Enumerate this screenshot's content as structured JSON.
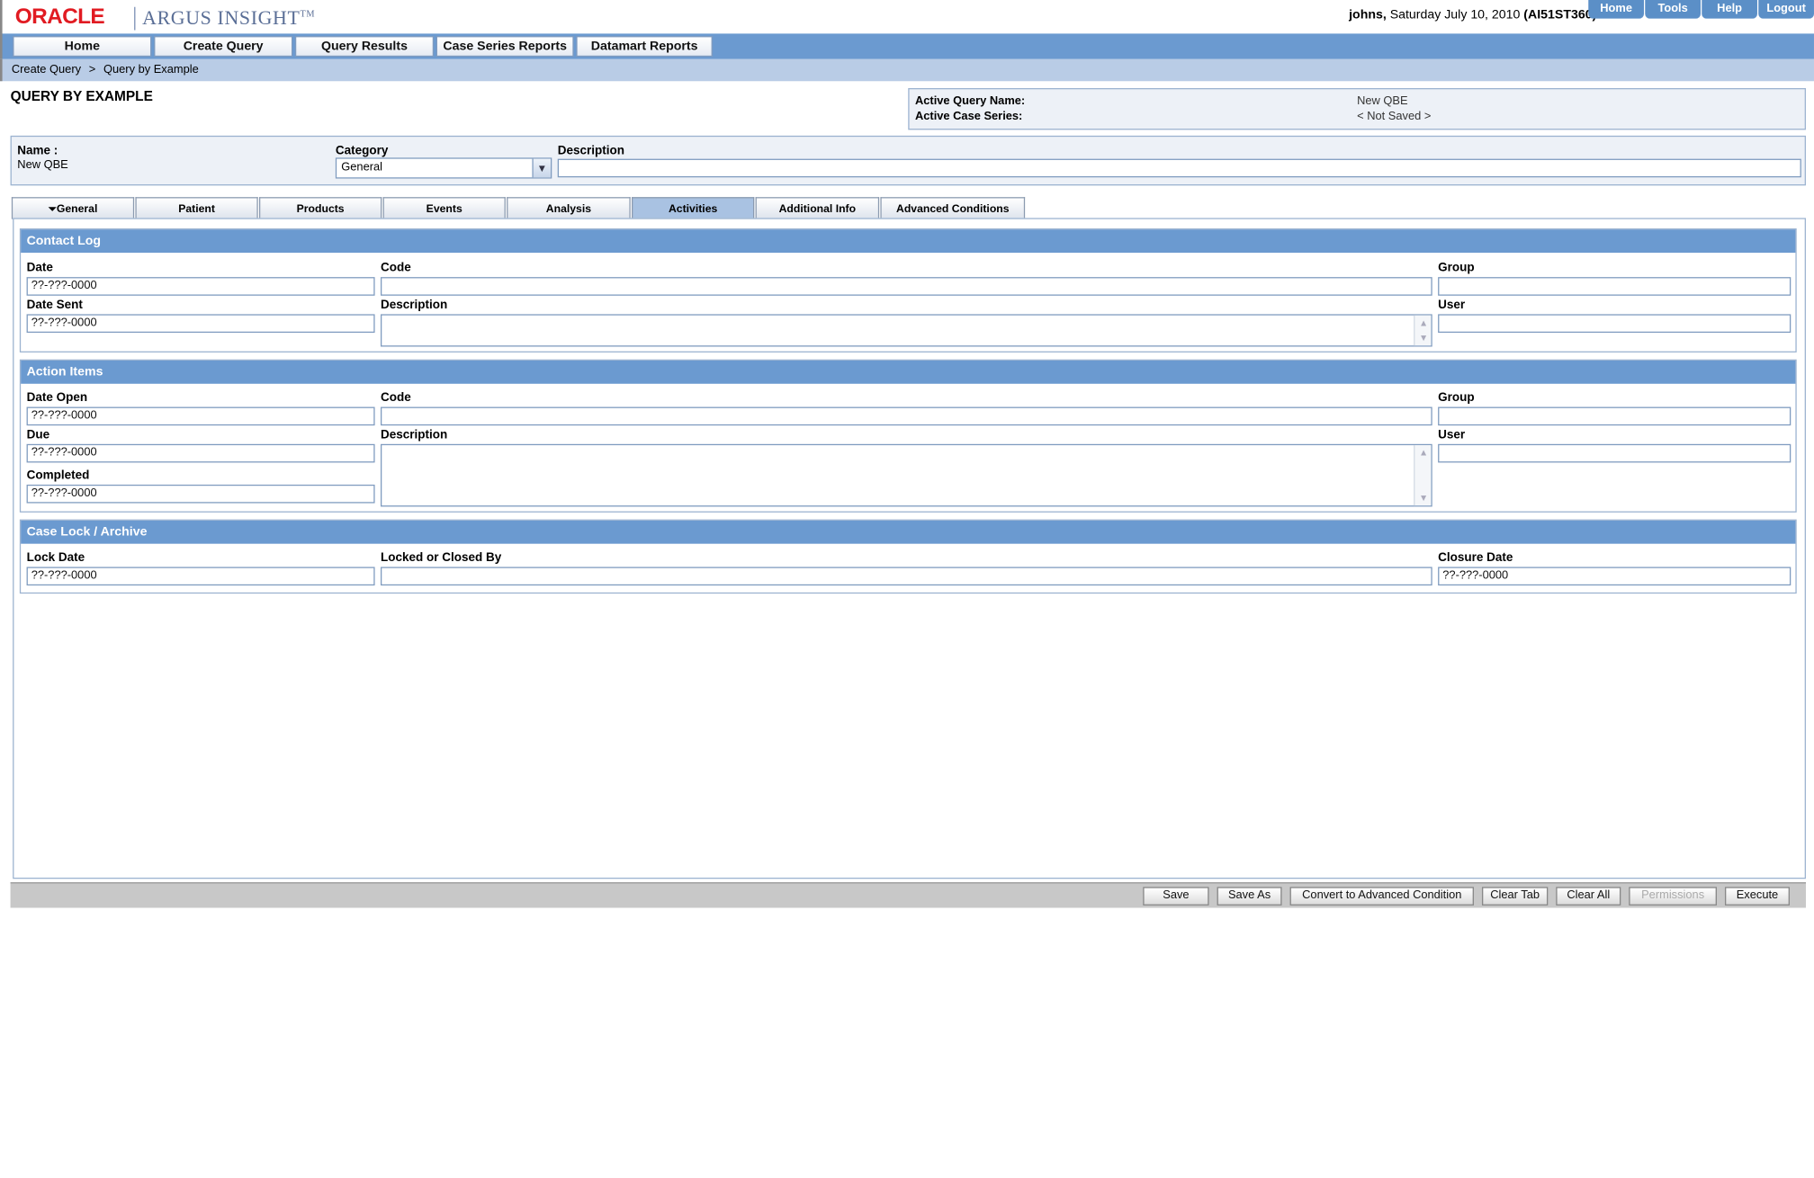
{
  "header": {
    "logo_oracle": "ORACLE",
    "logo_argus": "ARGUS INSIGHT",
    "logo_tm": "TM",
    "user": "johns,",
    "date": " Saturday July 10, 2010 ",
    "server": "(AI51ST360)",
    "top_links": [
      "Home",
      "Tools",
      "Help",
      "Logout"
    ]
  },
  "nav": {
    "items": [
      "Home",
      "Create Query",
      "Query Results",
      "Case Series Reports",
      "Datamart Reports"
    ]
  },
  "breadcrumb": {
    "parent": "Create Query",
    "separator": ">",
    "current": "Query by Example"
  },
  "page": {
    "title": "QUERY BY EXAMPLE"
  },
  "active": {
    "query_name_label": "Active Query Name:",
    "query_name_value": "New QBE",
    "case_series_label": "Active Case Series:",
    "case_series_value": "< Not Saved >"
  },
  "query_meta": {
    "name_label": "Name :",
    "name_value": "New QBE",
    "category_label": "Category",
    "category_value": "General",
    "description_label": "Description",
    "description_value": ""
  },
  "tabs": [
    {
      "label": "General",
      "icon": "filter-icon"
    },
    {
      "label": "Patient"
    },
    {
      "label": "Products"
    },
    {
      "label": "Events"
    },
    {
      "label": "Analysis"
    },
    {
      "label": "Activities",
      "active": true
    },
    {
      "label": "Additional Info"
    },
    {
      "label": "Advanced Conditions"
    }
  ],
  "contact_log": {
    "title": "Contact Log",
    "date_label": "Date",
    "date_value": "??-???-0000",
    "code_label": "Code",
    "group_label": "Group",
    "date_sent_label": "Date Sent",
    "date_sent_value": "??-???-0000",
    "description_label": "Description",
    "user_label": "User"
  },
  "action_items": {
    "title": "Action Items",
    "date_open_label": "Date Open",
    "date_open_value": "??-???-0000",
    "code_label": "Code",
    "group_label": "Group",
    "due_label": "Due",
    "due_value": "??-???-0000",
    "description_label": "Description",
    "user_label": "User",
    "completed_label": "Completed",
    "completed_value": "??-???-0000"
  },
  "case_lock": {
    "title": "Case Lock / Archive",
    "lock_date_label": "Lock Date",
    "lock_date_value": "??-???-0000",
    "locked_by_label": "Locked or Closed By",
    "closure_date_label": "Closure Date",
    "closure_date_value": "??-???-0000"
  },
  "buttons": {
    "save": "Save",
    "save_as": "Save As",
    "convert": "Convert to Advanced Condition",
    "clear_tab": "Clear Tab",
    "clear_all": "Clear All",
    "permissions": "Permissions",
    "execute": "Execute"
  },
  "colors": {
    "nav_blue": "#6b9ad0",
    "crumb_blue": "#b9cce6",
    "oracle_red": "#e11b22"
  }
}
